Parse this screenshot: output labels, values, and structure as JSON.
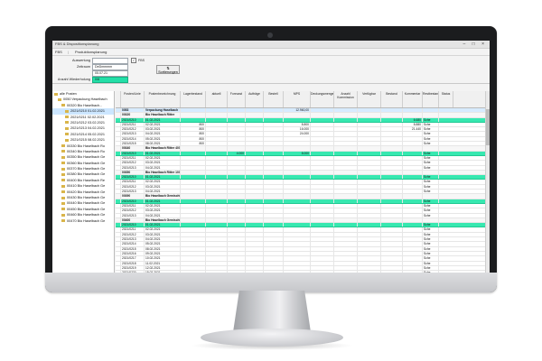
{
  "window": {
    "title": "FBS & Dispositionsplanung",
    "buttons": "– □ ×"
  },
  "tabs": [
    "FBS",
    "Produktionsplanung"
  ],
  "params": {
    "auswertung_label": "Auswertung",
    "auswertung_value": "",
    "mit_fbs_label": "FBS",
    "zeitraum_label": "Zeitraum",
    "zeitraum_value": "DeDmmmm",
    "datum_value": "05.07.21",
    "anzahl_label": "Anzahl Wiederholung",
    "anzahl_value": "0/8",
    "info_button": "Sortierungen"
  },
  "tree": [
    "alle Posten",
    "0050 Verpackung Haselbach",
    "00320 Bio Haselbach...",
    "2021/0210 01.02.2021",
    "2021/0211 02.02.2021",
    "2021/0212 03.02.2021",
    "2021/0213 04.02.2021",
    "2021/0214 05.02.2021",
    "2021/0215 08.02.2021",
    "00330 Bio Haselbach Ro",
    "00340 Bio Haselbach Ro",
    "00350 Bio Haselbach Ge",
    "00360 Bio Haselbach Ge",
    "00370 Bio Haselbach Ge",
    "00380 Bio Haselbach Ge",
    "00400 Bio Haselbach Re",
    "00410 Bio Haselbach Ge",
    "00420 Bio Haselbach Ge",
    "00430 Bio Haselbach Ge",
    "00440 Bio Haselbach Ge",
    "00450 Bio Haselbach Ge",
    "00460 Bio Haselbach Ge",
    "00470 Bio Haselbach Ge"
  ],
  "grid": {
    "columns": [
      "Posten/Linie",
      "Postenbezeichnung",
      "Lagerbestand",
      "aktuell",
      "Forecast",
      "Aufträge",
      "Bestell",
      "MPS",
      "Deckungsmenge",
      "Anzahl Kommission",
      "Verfügbar",
      "Bestand",
      "Kommentar",
      "Restbestand",
      "Status"
    ],
    "rows": [
      {
        "t": "top",
        "c": [
          "",
          "0053",
          "Verpackung Haselbach",
          "",
          "",
          "",
          "",
          "",
          "12.960,00",
          "",
          "",
          "",
          "",
          "",
          ""
        ]
      },
      {
        "t": "cat",
        "c": [
          "",
          "00320",
          "Bio Haselbach Ritter",
          "",
          "",
          "",
          "",
          "",
          "",
          "",
          "",
          "",
          "",
          "",
          ""
        ]
      },
      {
        "t": "hdr",
        "c": [
          "",
          "2021/0210",
          "01.02.2021",
          "",
          "",
          "",
          "",
          "",
          "",
          "",
          "",
          "",
          "",
          "6.680",
          "Sche"
        ]
      },
      {
        "t": "",
        "c": [
          "",
          "2021/0211",
          "02.02.2021",
          "800",
          "",
          "",
          "",
          "",
          "8.800",
          "",
          "",
          "",
          "",
          "8.880",
          "Sche"
        ]
      },
      {
        "t": "",
        "c": [
          "",
          "2021/0212",
          "03.02.2021",
          "800",
          "",
          "",
          "",
          "",
          "16.000",
          "",
          "",
          "",
          "",
          "21.440",
          "Sche"
        ]
      },
      {
        "t": "",
        "c": [
          "",
          "2021/0213",
          "04.02.2021",
          "800",
          "",
          "",
          "",
          "",
          "24.000",
          "",
          "",
          "",
          "",
          "",
          "Sche"
        ]
      },
      {
        "t": "",
        "c": [
          "",
          "2021/0214",
          "05.02.2021",
          "800",
          "",
          "",
          "",
          "",
          "",
          "",
          "",
          "",
          "",
          "",
          "Sche"
        ]
      },
      {
        "t": "",
        "c": [
          "",
          "2021/0215",
          "08.02.2021",
          "800",
          "",
          "",
          "",
          "",
          "",
          "",
          "",
          "",
          "",
          "",
          "Sche"
        ]
      },
      {
        "t": "cat",
        "c": [
          "",
          "00340",
          "Bio Haselbach Ritter 400g",
          "",
          "",
          "",
          "",
          "",
          "",
          "",
          "",
          "",
          "",
          "",
          ""
        ]
      },
      {
        "t": "hdr",
        "c": [
          "",
          "2021/0210",
          "01.02.2021",
          "",
          "",
          "4.000",
          "",
          "",
          "8.000",
          "",
          "",
          "",
          "",
          "",
          "Sche"
        ]
      },
      {
        "t": "",
        "c": [
          "",
          "2021/0211",
          "02.02.2021",
          "",
          "",
          "",
          "",
          "",
          "",
          "",
          "",
          "",
          "",
          "",
          "Sche"
        ]
      },
      {
        "t": "",
        "c": [
          "",
          "2021/0212",
          "03.02.2021",
          "",
          "",
          "",
          "",
          "",
          "",
          "",
          "",
          "",
          "",
          "",
          "Sche"
        ]
      },
      {
        "t": "",
        "c": [
          "",
          "2021/0213",
          "04.02.2021",
          "",
          "",
          "",
          "",
          "",
          "",
          "",
          "",
          "",
          "",
          "",
          "Sche"
        ]
      },
      {
        "t": "cat",
        "c": [
          "",
          "00350",
          "Bio Haselbach Ritter 100g",
          "",
          "",
          "",
          "",
          "",
          "",
          "",
          "",
          "",
          "",
          "",
          ""
        ]
      },
      {
        "t": "hdr",
        "c": [
          "",
          "2021/0210",
          "01.02.2021",
          "",
          "",
          "",
          "",
          "",
          "",
          "",
          "",
          "",
          "",
          "",
          "Sche"
        ]
      },
      {
        "t": "",
        "c": [
          "",
          "2021/0211",
          "02.02.2021",
          "",
          "",
          "",
          "",
          "",
          "",
          "",
          "",
          "",
          "",
          "",
          "Sche"
        ]
      },
      {
        "t": "",
        "c": [
          "",
          "2021/0212",
          "03.02.2021",
          "",
          "",
          "",
          "",
          "",
          "",
          "",
          "",
          "",
          "",
          "",
          "Sche"
        ]
      },
      {
        "t": "",
        "c": [
          "",
          "2021/0213",
          "04.02.2021",
          "",
          "",
          "",
          "",
          "",
          "",
          "",
          "",
          "",
          "",
          "",
          "Sche"
        ]
      },
      {
        "t": "cat",
        "c": [
          "",
          "00390",
          "Bio Haselbach Gemischt 250g",
          "",
          "",
          "",
          "",
          "",
          "",
          "",
          "",
          "",
          "",
          "",
          ""
        ]
      },
      {
        "t": "hdr",
        "c": [
          "",
          "2021/0210",
          "01.02.2021",
          "",
          "",
          "",
          "",
          "",
          "",
          "",
          "",
          "",
          "",
          "",
          "Sche"
        ]
      },
      {
        "t": "",
        "c": [
          "",
          "2021/0211",
          "02.02.2021",
          "",
          "",
          "",
          "",
          "",
          "",
          "",
          "",
          "",
          "",
          "",
          "Sche"
        ]
      },
      {
        "t": "",
        "c": [
          "",
          "2021/0212",
          "03.02.2021",
          "",
          "",
          "",
          "",
          "",
          "",
          "",
          "",
          "",
          "",
          "",
          "Sche"
        ]
      },
      {
        "t": "",
        "c": [
          "",
          "2021/0213",
          "04.02.2021",
          "",
          "",
          "",
          "",
          "",
          "",
          "",
          "",
          "",
          "",
          "",
          "Sche"
        ]
      },
      {
        "t": "cat",
        "c": [
          "",
          "00400",
          "Bio Haselbach Gemischt 400g",
          "",
          "",
          "",
          "",
          "",
          "",
          "",
          "",
          "",
          "",
          "",
          ""
        ]
      },
      {
        "t": "hdr",
        "c": [
          "",
          "2021/0210",
          "01.02.2021",
          "",
          "",
          "",
          "",
          "",
          "",
          "",
          "",
          "",
          "",
          "",
          "Sche"
        ]
      },
      {
        "t": "",
        "c": [
          "",
          "2021/0211",
          "02.02.2021",
          "",
          "",
          "",
          "",
          "",
          "",
          "",
          "",
          "",
          "",
          "",
          "Sche"
        ]
      },
      {
        "t": "",
        "c": [
          "",
          "2021/0212",
          "03.02.2021",
          "",
          "",
          "",
          "",
          "",
          "",
          "",
          "",
          "",
          "",
          "",
          "Sche"
        ]
      },
      {
        "t": "",
        "c": [
          "",
          "2021/0213",
          "04.02.2021",
          "",
          "",
          "",
          "",
          "",
          "",
          "",
          "",
          "",
          "",
          "",
          "Sche"
        ]
      },
      {
        "t": "",
        "c": [
          "",
          "2021/0214",
          "05.02.2021",
          "",
          "",
          "",
          "",
          "",
          "",
          "",
          "",
          "",
          "",
          "",
          "Sche"
        ]
      },
      {
        "t": "",
        "c": [
          "",
          "2021/0215",
          "08.02.2021",
          "",
          "",
          "",
          "",
          "",
          "",
          "",
          "",
          "",
          "",
          "",
          "Sche"
        ]
      },
      {
        "t": "",
        "c": [
          "",
          "2021/0216",
          "09.02.2021",
          "",
          "",
          "",
          "",
          "",
          "",
          "",
          "",
          "",
          "",
          "",
          "Sche"
        ]
      },
      {
        "t": "",
        "c": [
          "",
          "2021/0217",
          "10.02.2021",
          "",
          "",
          "",
          "",
          "",
          "",
          "",
          "",
          "",
          "",
          "",
          "Sche"
        ]
      },
      {
        "t": "",
        "c": [
          "",
          "2021/0218",
          "11.02.2021",
          "",
          "",
          "",
          "",
          "",
          "",
          "",
          "",
          "",
          "",
          "",
          "Sche"
        ]
      },
      {
        "t": "",
        "c": [
          "",
          "2021/0219",
          "12.02.2021",
          "",
          "",
          "",
          "",
          "",
          "",
          "",
          "",
          "",
          "",
          "",
          "Sche"
        ]
      },
      {
        "t": "",
        "c": [
          "",
          "2021/0220",
          "15.02.2021",
          "",
          "",
          "",
          "",
          "",
          "",
          "",
          "",
          "",
          "",
          "",
          "Sche"
        ]
      }
    ]
  }
}
